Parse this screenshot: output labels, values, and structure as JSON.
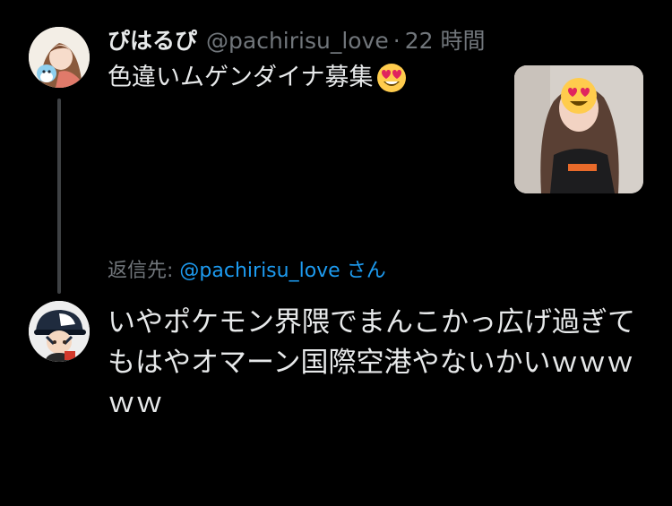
{
  "original_tweet": {
    "display_name": "ぴはるぴ",
    "handle": "@pachirisu_love",
    "separator": "·",
    "time": "22 時間",
    "text": "色違いムゲンダイナ募集",
    "emoji": "heart-eyes"
  },
  "reply": {
    "prefix": "返信先:",
    "mention": "@pachirisu_love",
    "suffix": "さん",
    "text": "いやポケモン界隈でまんこかっ広げ過ぎてもはやオマーン国際空港やないかいｗｗｗｗｗ"
  },
  "colors": {
    "background": "#000000",
    "text": "#e7e9ea",
    "secondary": "#71767b",
    "link": "#1d9bf0",
    "thread_line": "#3e4144"
  }
}
